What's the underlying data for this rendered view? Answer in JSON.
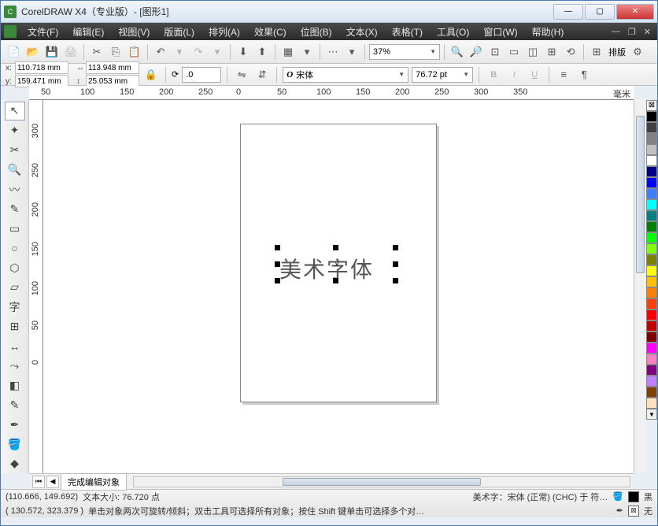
{
  "title": "CorelDRAW X4（专业版）- [图形1]",
  "menu": [
    "文件(F)",
    "编辑(E)",
    "视图(V)",
    "版面(L)",
    "排列(A)",
    "效果(C)",
    "位图(B)",
    "文本(X)",
    "表格(T)",
    "工具(O)",
    "窗口(W)",
    "帮助(H)"
  ],
  "zoom": "37%",
  "layout_label": "排版",
  "prop": {
    "x_label": "x:",
    "y_label": "y:",
    "x": "110.718 mm",
    "y": "159.471 mm",
    "w": "113.948 mm",
    "h": "25.053 mm",
    "rotate": ".0",
    "font_name": "宋体",
    "font_size": "76.72 pt"
  },
  "ruler_h": [
    "0",
    "50",
    "100",
    "150",
    "200",
    "250",
    "300",
    "350",
    "50",
    "100",
    "150",
    "200",
    "250",
    "300",
    "350"
  ],
  "ruler_v": [
    "300",
    "250",
    "200",
    "150",
    "100",
    "50",
    "0"
  ],
  "ruler_unit": "毫米",
  "canvas_text": "美术字体",
  "tab": {
    "label": "完成编辑对象"
  },
  "status": {
    "line1_coord": "(110.666, 149.692)",
    "line1_text": "文本大小: 76.720 点",
    "line1_right": "美术字：宋体 (正常) (CHC) 于 符…",
    "fill_label": "黑",
    "line2_coord": "( 130.572, 323.379 )",
    "line2_text": "单击对象两次可旋转/倾斜；双击工具可选择所有对象；按住 Shift 键单击可选择多个对…",
    "outline_label": "无"
  },
  "palette": [
    "#000000",
    "#ffffff",
    "#f5f5dc",
    "#404040",
    "#808080",
    "#c0c0c0",
    "#000080",
    "#0000ff",
    "#00ffff",
    "#008080",
    "#008000",
    "#00ff00",
    "#808000",
    "#ffff00",
    "#ff8000",
    "#ff0000",
    "#800000",
    "#ff00ff",
    "#800080",
    "#ffc0cb"
  ],
  "tools": [
    "pick",
    "shape",
    "crop",
    "zoom",
    "freehand",
    "smart",
    "rect",
    "ellipse",
    "polygon",
    "basic",
    "text",
    "table",
    "dimension",
    "connector",
    "effects",
    "eyedrop",
    "outline",
    "fill",
    "ifill"
  ]
}
